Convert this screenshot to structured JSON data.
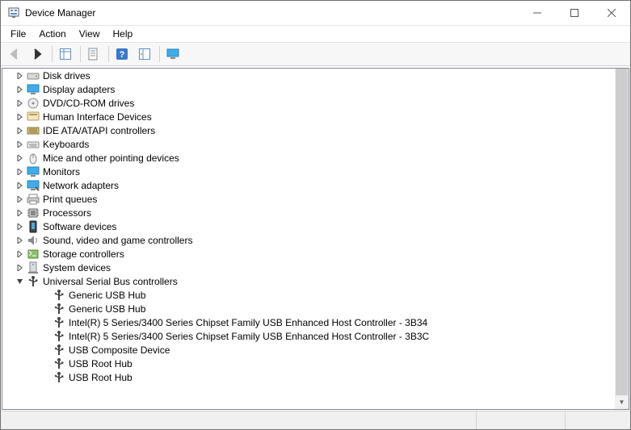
{
  "window": {
    "title": "Device Manager"
  },
  "menu": {
    "file": "File",
    "action": "Action",
    "view": "View",
    "help": "Help"
  },
  "toolbar": {
    "back": "back-icon",
    "forward": "forward-icon",
    "show_hide": "show-hide-console-tree-icon",
    "properties": "properties-icon",
    "help": "help-icon",
    "scan": "scan-for-hardware-changes-icon",
    "monitor": "monitor-icon"
  },
  "tree": {
    "categories": [
      {
        "label": "Disk drives",
        "icon": "disk",
        "expanded": false
      },
      {
        "label": "Display adapters",
        "icon": "display",
        "expanded": false
      },
      {
        "label": "DVD/CD-ROM drives",
        "icon": "dvd",
        "expanded": false
      },
      {
        "label": "Human Interface Devices",
        "icon": "hid",
        "expanded": false
      },
      {
        "label": "IDE ATA/ATAPI controllers",
        "icon": "ide",
        "expanded": false
      },
      {
        "label": "Keyboards",
        "icon": "keyboard",
        "expanded": false
      },
      {
        "label": "Mice and other pointing devices",
        "icon": "mouse",
        "expanded": false
      },
      {
        "label": "Monitors",
        "icon": "monitor",
        "expanded": false
      },
      {
        "label": "Network adapters",
        "icon": "network",
        "expanded": false
      },
      {
        "label": "Print queues",
        "icon": "printer",
        "expanded": false
      },
      {
        "label": "Processors",
        "icon": "cpu",
        "expanded": false
      },
      {
        "label": "Software devices",
        "icon": "software",
        "expanded": false
      },
      {
        "label": "Sound, video and game controllers",
        "icon": "sound",
        "expanded": false
      },
      {
        "label": "Storage controllers",
        "icon": "storage",
        "expanded": false
      },
      {
        "label": "System devices",
        "icon": "system",
        "expanded": false
      },
      {
        "label": "Universal Serial Bus controllers",
        "icon": "usb",
        "expanded": true,
        "children": [
          {
            "label": "Generic USB Hub",
            "icon": "usb"
          },
          {
            "label": "Generic USB Hub",
            "icon": "usb"
          },
          {
            "label": "Intel(R) 5 Series/3400 Series Chipset Family USB Enhanced Host Controller - 3B34",
            "icon": "usb"
          },
          {
            "label": "Intel(R) 5 Series/3400 Series Chipset Family USB Enhanced Host Controller - 3B3C",
            "icon": "usb"
          },
          {
            "label": "USB Composite Device",
            "icon": "usb"
          },
          {
            "label": "USB Root Hub",
            "icon": "usb"
          },
          {
            "label": "USB Root Hub",
            "icon": "usb"
          }
        ]
      }
    ]
  }
}
